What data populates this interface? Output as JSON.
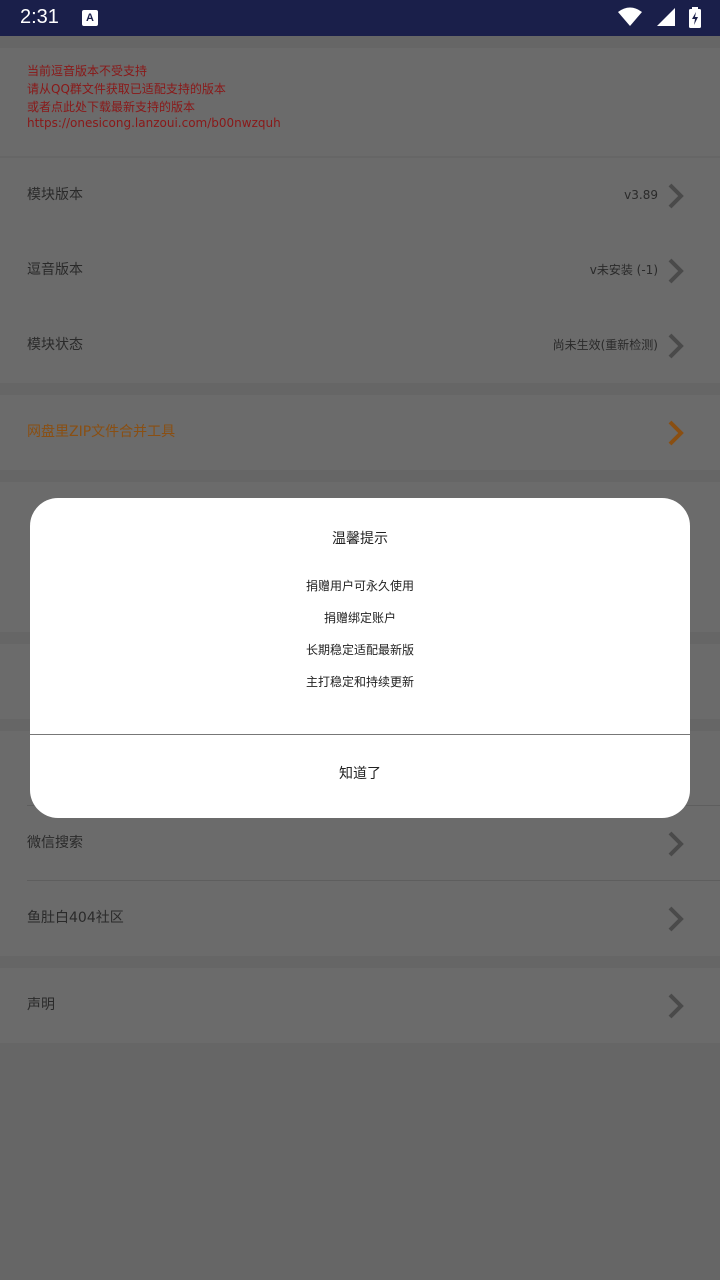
{
  "status_bar": {
    "time": "2:31",
    "notification_icon": "A"
  },
  "notice": {
    "lines": [
      "当前逗音版本不受支持",
      "请从QQ群文件获取已适配支持的版本",
      "或者点此处下载最新支持的版本",
      "https://onesicong.lanzoui.com/b00nwzquh"
    ],
    "color": "#8a1818"
  },
  "settings": {
    "module_version": {
      "label": "模块版本",
      "value": "v3.89"
    },
    "app_version": {
      "label": "逗音版本",
      "value": "v未安装 (-1)"
    },
    "module_status": {
      "label": "模块状态",
      "value": "尚未生效(重新检测)"
    },
    "zip_tool": {
      "label": "网盘里ZIP文件合并工具",
      "color": "#8a4f12"
    },
    "wechat_search": {
      "label": "微信搜索"
    },
    "community": {
      "label": "鱼肚白404社区"
    },
    "statement": {
      "label": "声明"
    }
  },
  "dialog": {
    "title": "温馨提示",
    "lines": [
      "捐赠用户可永久使用",
      "捐赠绑定账户",
      "长期稳定适配最新版",
      "主打稳定和持续更新"
    ],
    "ok_label": "知道了"
  },
  "icons": {
    "wifi": "wifi-icon",
    "signal": "cell-signal-icon",
    "battery": "battery-charging-icon",
    "chevron": "chevron-right-icon"
  }
}
